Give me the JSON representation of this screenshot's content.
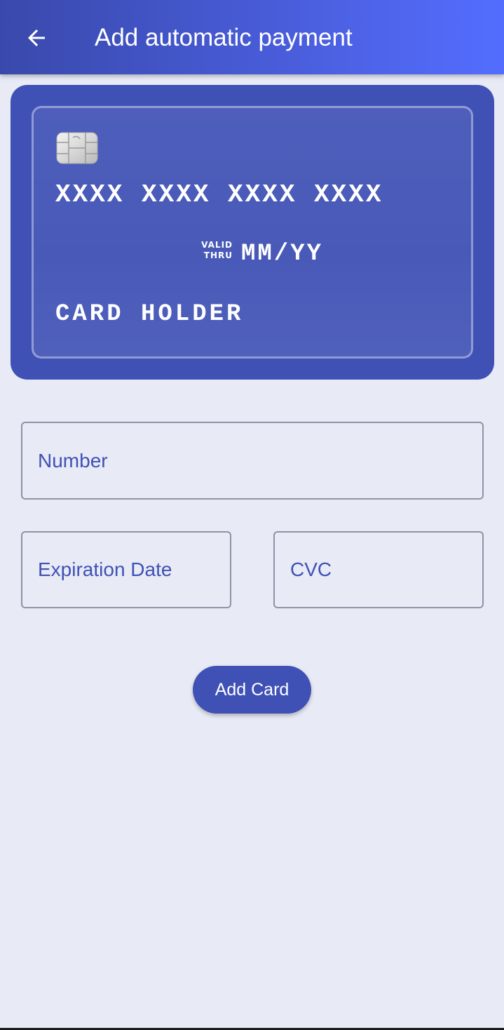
{
  "app_bar": {
    "title": "Add automatic payment",
    "back_icon": "arrow-back-icon"
  },
  "card": {
    "chip_icon": "card-chip-icon",
    "number": "XXXX XXXX XXXX XXXX",
    "valid_label_line1": "VALID",
    "valid_label_line2": "THRU",
    "expiry": "MM/YY",
    "holder": "CARD HOLDER",
    "color": "#3f51b5"
  },
  "form": {
    "number_placeholder": "Number",
    "expiration_placeholder": "Expiration Date",
    "cvc_placeholder": "CVC",
    "submit_label": "Add Card"
  },
  "colors": {
    "accent": "#3f51b5",
    "background": "#e8eaf6",
    "app_bar_gradient_start": "#3949ab",
    "app_bar_gradient_end": "#536dfe"
  }
}
